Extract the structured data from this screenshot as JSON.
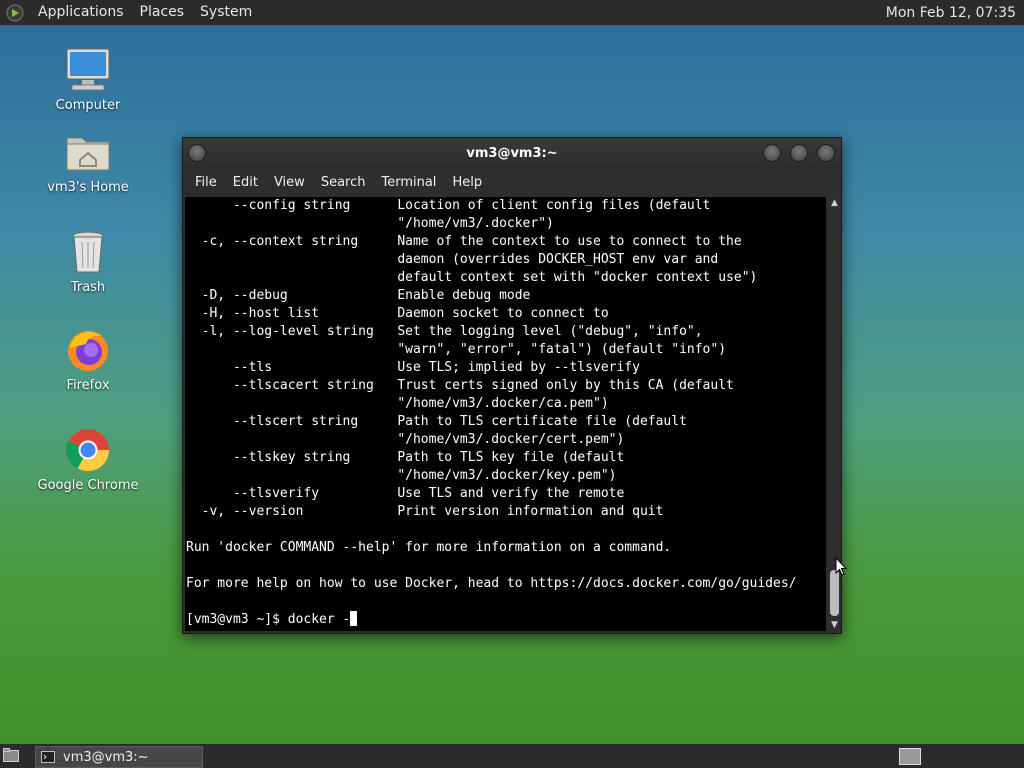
{
  "top_panel": {
    "menus": [
      "Applications",
      "Places",
      "System"
    ],
    "clock": "Mon Feb 12, 07:35"
  },
  "desktop_icons": [
    {
      "label": "Computer",
      "icon": "computer-icon"
    },
    {
      "label": "vm3's Home",
      "icon": "home-folder-icon"
    },
    {
      "label": "Trash",
      "icon": "trash-icon"
    },
    {
      "label": "Firefox",
      "icon": "firefox-icon"
    },
    {
      "label": "Google Chrome",
      "icon": "chrome-icon"
    }
  ],
  "window": {
    "title": "vm3@vm3:~",
    "menus": [
      "File",
      "Edit",
      "View",
      "Search",
      "Terminal",
      "Help"
    ]
  },
  "terminal": {
    "lines": [
      "      --config string      Location of client config files (default",
      "                           \"/home/vm3/.docker\")",
      "  -c, --context string     Name of the context to use to connect to the",
      "                           daemon (overrides DOCKER_HOST env var and",
      "                           default context set with \"docker context use\")",
      "  -D, --debug              Enable debug mode",
      "  -H, --host list          Daemon socket to connect to",
      "  -l, --log-level string   Set the logging level (\"debug\", \"info\",",
      "                           \"warn\", \"error\", \"fatal\") (default \"info\")",
      "      --tls                Use TLS; implied by --tlsverify",
      "      --tlscacert string   Trust certs signed only by this CA (default",
      "                           \"/home/vm3/.docker/ca.pem\")",
      "      --tlscert string     Path to TLS certificate file (default",
      "                           \"/home/vm3/.docker/cert.pem\")",
      "      --tlskey string      Path to TLS key file (default",
      "                           \"/home/vm3/.docker/key.pem\")",
      "      --tlsverify          Use TLS and verify the remote",
      "  -v, --version            Print version information and quit",
      "",
      "Run 'docker COMMAND --help' for more information on a command.",
      "",
      "For more help on how to use Docker, head to https://docs.docker.com/go/guides/",
      ""
    ],
    "prompt": "[vm3@vm3 ~]$ docker -"
  },
  "taskbar": {
    "task_label": "vm3@vm3:~"
  }
}
